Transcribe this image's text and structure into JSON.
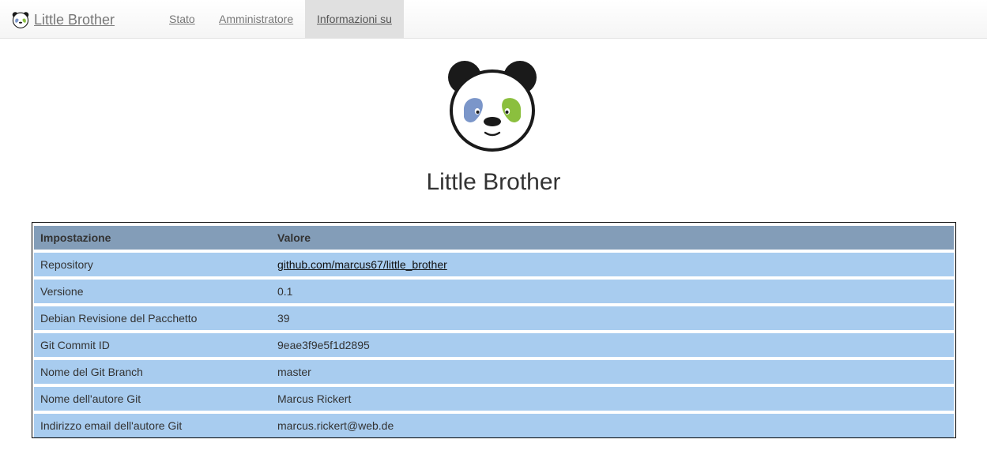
{
  "navbar": {
    "brand": "Little Brother",
    "items": [
      {
        "label": "Stato"
      },
      {
        "label": "Amministratore"
      },
      {
        "label": "Informazioni su"
      }
    ]
  },
  "page": {
    "title": "Little Brother"
  },
  "table": {
    "headers": [
      "Impostazione",
      "Valore"
    ],
    "rows": [
      [
        "Repository",
        "github.com/marcus67/little_brother"
      ],
      [
        "Versione",
        "0.1"
      ],
      [
        "Debian Revisione del Pacchetto",
        "39"
      ],
      [
        "Git Commit ID",
        "9eae3f9e5f1d2895"
      ],
      [
        "Nome del Git Branch",
        "master"
      ],
      [
        "Nome dell'autore Git",
        "Marcus Rickert"
      ],
      [
        "Indirizzo email dell'autore Git",
        "marcus.rickert@web.de"
      ]
    ]
  },
  "colors": {
    "header_row": "#839db8",
    "data_row": "#a8ccef",
    "eye_left": "#7b96c9",
    "eye_right": "#8bbf3e"
  }
}
